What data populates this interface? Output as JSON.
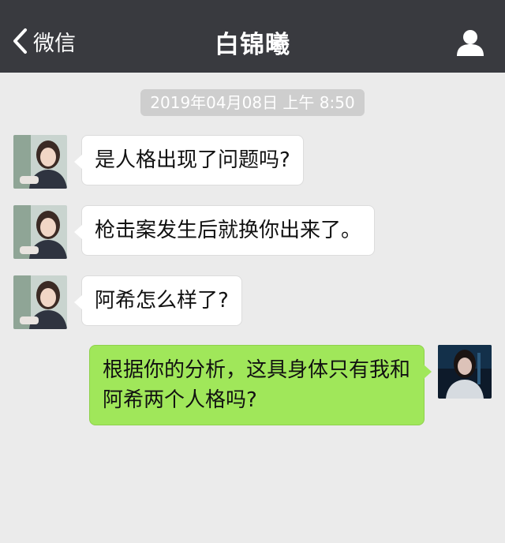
{
  "nav": {
    "back_label": "微信",
    "title": "白锦曦",
    "back_icon": "chevron-left-icon",
    "profile_icon": "person-icon"
  },
  "timestamp": "2019年04月08日 上午 8:50",
  "messages": [
    {
      "side": "left",
      "text": "是人格出现了问题吗?"
    },
    {
      "side": "left",
      "text": "枪击案发生后就换你出来了。"
    },
    {
      "side": "left",
      "text": "阿希怎么样了?"
    },
    {
      "side": "right",
      "text": "根据你的分析，这具身体只有我和阿希两个人格吗?"
    }
  ],
  "colors": {
    "nav_bg": "#393a3f",
    "chat_bg": "#ebebeb",
    "incoming_bubble": "#ffffff",
    "outgoing_bubble": "#a0e75a"
  }
}
